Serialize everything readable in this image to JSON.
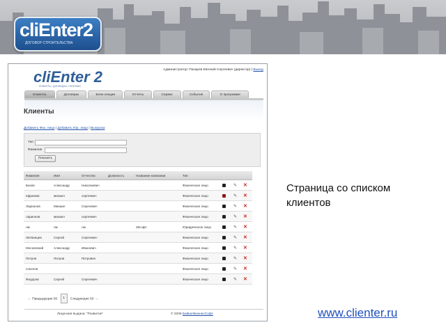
{
  "banner": {
    "logo_text": "cliEnter2",
    "logo_subtitle": "ДОГОВОР СТРОИТЕЛЬСТВА"
  },
  "app": {
    "logo": "cliEnter 2",
    "tagline": "клиенты, договоры, платежи",
    "user_text": "Администратор: Пахарев Евгений Сергеевич (директор) |",
    "logout": "Выход"
  },
  "tabs": [
    {
      "label": "Клиенты",
      "active": true
    },
    {
      "label": "Договоры",
      "active": false
    },
    {
      "label": "Блок-секции",
      "active": false
    },
    {
      "label": "Отчеты",
      "active": false
    },
    {
      "label": "Сервис",
      "active": false
    },
    {
      "label": "События",
      "active": false
    },
    {
      "label": "О программе",
      "active": false
    }
  ],
  "page": {
    "title": "Клиенты",
    "action_add_fiz": "Добавить Физ. лицо",
    "action_add_jur": "Добавить Юр. лицо",
    "action_export": "Выгрузка",
    "sep": "|"
  },
  "filter": {
    "type_label": "Тип",
    "type_value": "-",
    "surname_label": "Фамилия",
    "surname_value": "",
    "find_button": "Показать"
  },
  "grid": {
    "columns": [
      "Фамилия",
      "Имя",
      "Отчество",
      "Должность",
      "Название компании",
      "Тип"
    ],
    "rows": [
      {
        "c": [
          "Бизов",
          "Александр",
          "Николаевич",
          "",
          "",
          "Физическое лицо"
        ],
        "red": false
      },
      {
        "c": [
          "ефремов",
          "михаил",
          "сергеевич",
          "",
          "",
          "Физическое лицо"
        ],
        "red": true
      },
      {
        "c": [
          "Ларионов",
          "Михаил",
          "Сергеевич",
          "",
          "",
          "Физическое лицо"
        ],
        "red": false
      },
      {
        "c": [
          "ларионов",
          "михаил",
          "сергеевич",
          "",
          "",
          "Физическое лицо"
        ],
        "red": false
      },
      {
        "c": [
          "лм",
          "лм",
          "лм",
          "",
          "28сэфт",
          "Юридическое лицо"
        ],
        "red": false
      },
      {
        "c": [
          "Литвинцев",
          "Сергей",
          "Сергеевич",
          "",
          "",
          "Физическое лицо"
        ],
        "red": false
      },
      {
        "c": [
          "Московский",
          "Александр",
          "Иванович",
          "",
          "",
          "Физическое лицо"
        ],
        "red": false
      },
      {
        "c": [
          "Петров",
          "Петров",
          "Петрович",
          "",
          "",
          "Физическое лицо"
        ],
        "red": false
      },
      {
        "c": [
          "соколов",
          "",
          "",
          "",
          "",
          "Физическое лицо"
        ],
        "red": false
      },
      {
        "c": [
          "Федоров",
          "Сергей",
          "Сергеевич",
          "",
          "",
          "Физическое лицо"
        ],
        "red": false
      }
    ]
  },
  "pager": {
    "prev": "← Предыдущие 50",
    "page": "1",
    "next": "Следующие 50 →"
  },
  "footer": {
    "left": "Лицензия выдана: \"Развитие\"",
    "right_prefix": "© 2008",
    "right_link": "БайкалБизнесСофт"
  },
  "caption": "Страница со списком клиентов",
  "site_url": "www.clienter.ru"
}
